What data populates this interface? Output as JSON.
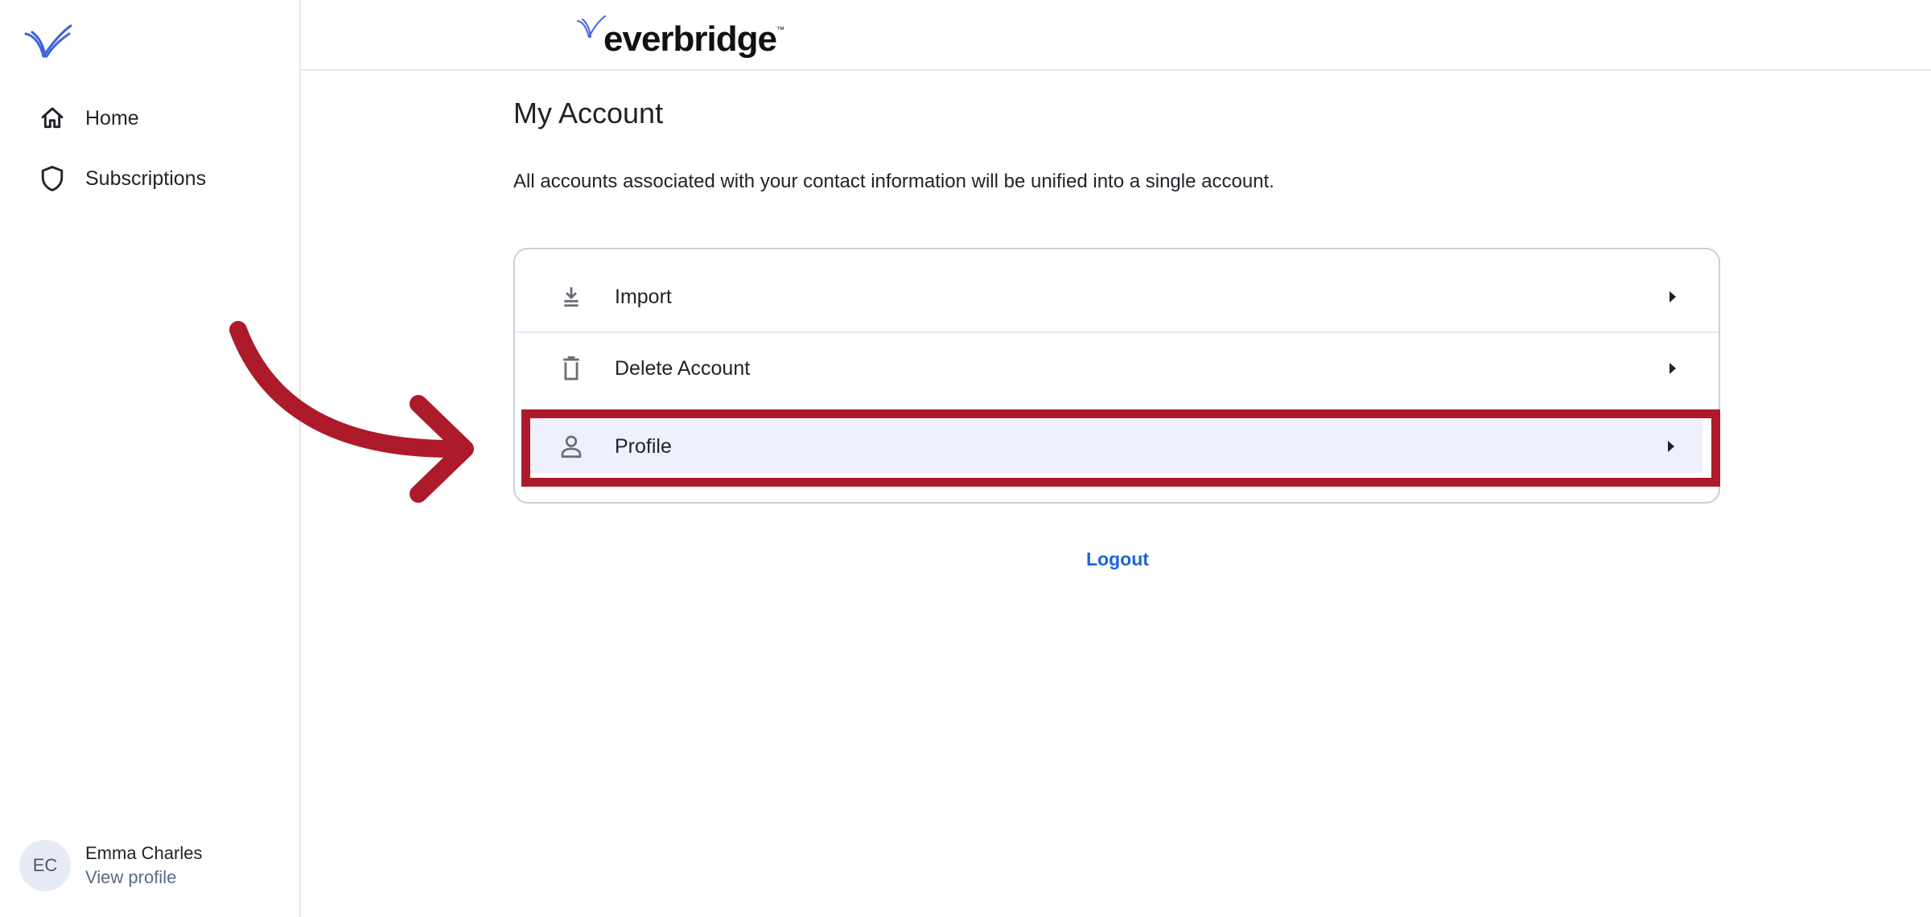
{
  "brand": {
    "name": "everbridge",
    "tm": "™"
  },
  "sidebar": {
    "items": [
      {
        "label": "Home",
        "icon": "home-icon"
      },
      {
        "label": "Subscriptions",
        "icon": "shield-icon"
      }
    ]
  },
  "user": {
    "initials": "EC",
    "name": "Emma Charles",
    "link": "View profile"
  },
  "main": {
    "title": "My Account",
    "description": "All accounts associated with your contact information will be unified into a single account.",
    "menu": [
      {
        "label": "Import",
        "icon": "download-icon"
      },
      {
        "label": "Delete Account",
        "icon": "trash-icon"
      },
      {
        "label": "Profile",
        "icon": "person-icon"
      }
    ],
    "logout": "Logout"
  },
  "colors": {
    "accent": "#1a66d6",
    "highlight": "#ad1a2b",
    "selected_row": "#eef1fb",
    "brand_mark": "#3d64d8"
  }
}
